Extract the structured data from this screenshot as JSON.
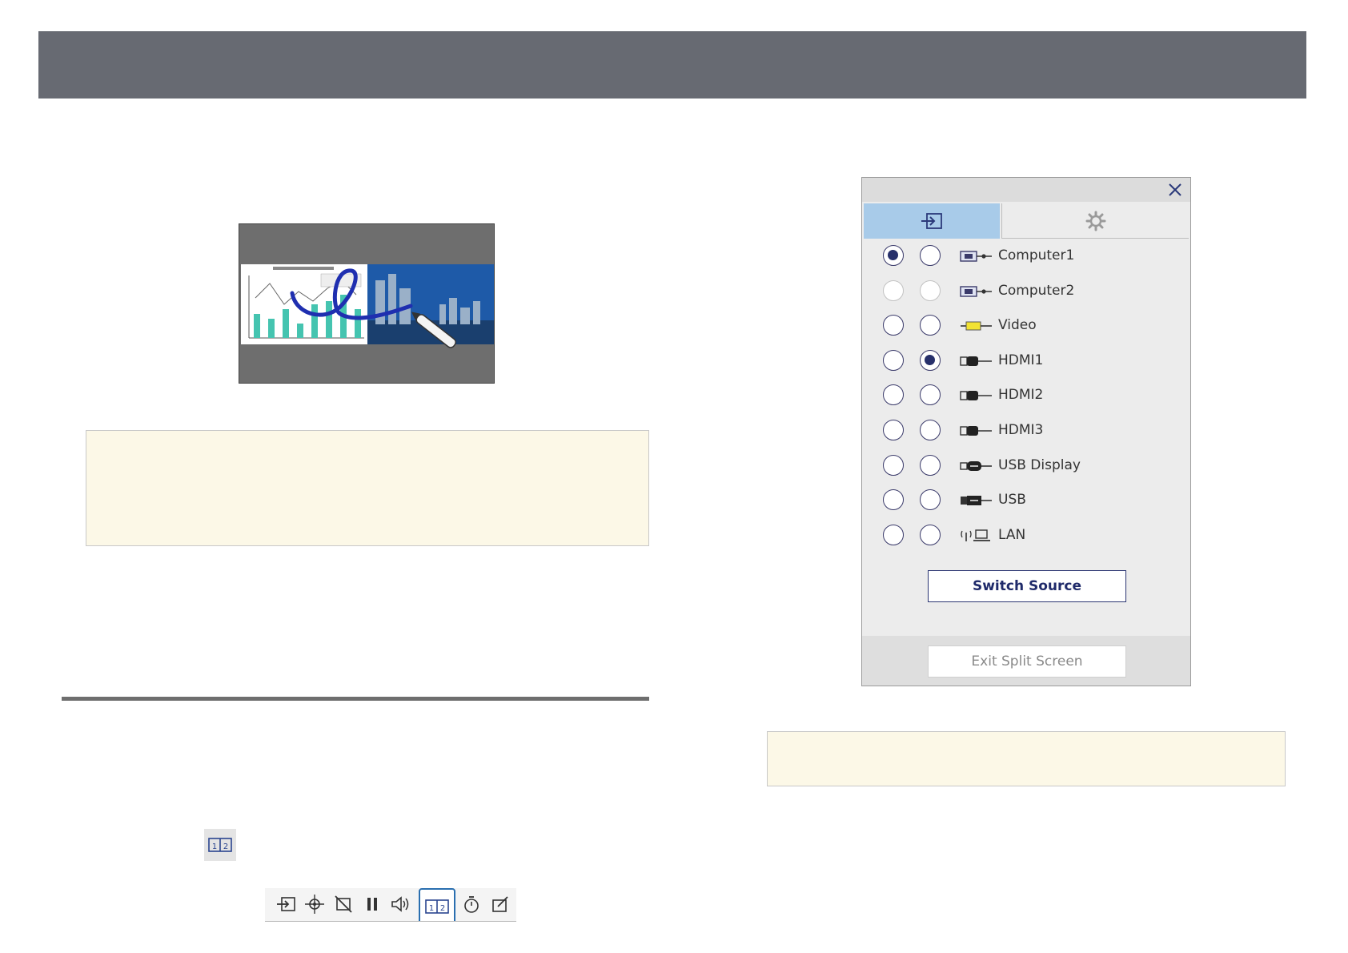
{
  "source_panel": {
    "tabs": [
      {
        "icon": "source-input-icon",
        "selected": true
      },
      {
        "icon": "gear-icon",
        "selected": false
      }
    ],
    "sources": [
      {
        "label": "Computer1",
        "icon": "computer-port-icon",
        "left_selected": true,
        "right_selected": false,
        "disabled": false
      },
      {
        "label": "Computer2",
        "icon": "computer-port-icon",
        "left_selected": false,
        "right_selected": false,
        "disabled": true
      },
      {
        "label": "Video",
        "icon": "video-rca-icon",
        "left_selected": false,
        "right_selected": false,
        "disabled": false
      },
      {
        "label": "HDMI1",
        "icon": "hdmi-port-icon",
        "left_selected": false,
        "right_selected": true,
        "disabled": false
      },
      {
        "label": "HDMI2",
        "icon": "hdmi-port-icon",
        "left_selected": false,
        "right_selected": false,
        "disabled": false
      },
      {
        "label": "HDMI3",
        "icon": "hdmi-port-icon",
        "left_selected": false,
        "right_selected": false,
        "disabled": false
      },
      {
        "label": "USB Display",
        "icon": "usb-display-icon",
        "left_selected": false,
        "right_selected": false,
        "disabled": false
      },
      {
        "label": "USB",
        "icon": "usb-port-icon",
        "left_selected": false,
        "right_selected": false,
        "disabled": false
      },
      {
        "label": "LAN",
        "icon": "lan-wireless-icon",
        "left_selected": false,
        "right_selected": false,
        "disabled": false
      }
    ],
    "switch_label": "Switch Source",
    "exit_label": "Exit Split Screen"
  },
  "toolbar": {
    "buttons": [
      "source-icon",
      "move-icon",
      "blank-icon",
      "pause-icon",
      "volume-icon",
      "split-screen-icon",
      "timer-icon",
      "annotation-icon"
    ],
    "active": "split-screen-icon"
  },
  "split_icon_label": "1|2"
}
